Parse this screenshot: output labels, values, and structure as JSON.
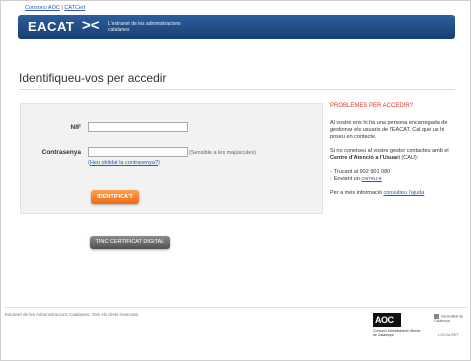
{
  "top_links": {
    "consorci": "Consorci AOC",
    "separator": "|",
    "catcert": "CATCert"
  },
  "banner": {
    "logo_text": "EACAT",
    "logo_mark": "><",
    "tagline": "L'extranet de les administracions catalanes"
  },
  "page_title": "Identifiqueu-vos per accedir",
  "form": {
    "nif_label": "NIF",
    "nif_value": "",
    "password_label": "Contrasenya",
    "password_value": "",
    "password_hint": "(Sensible a les majúscules)",
    "forgot_link": "Heu oblidat la contrasenya?",
    "forgot_prefix": "(",
    "forgot_suffix": ")",
    "submit_label": "IDENTIFICA'T"
  },
  "certificate_button": "TINC CERTIFICAT DIGITAL",
  "side": {
    "title": "PROBLEMES PER ACCEDIR?",
    "para1": "Al vostre ens hi ha una persona encarregada de gestionar els usuaris de l'EACAT. Cal que us hi poseu en contacte.",
    "para2_pre": "Si no coneixeu al vostre gestor contacteu amb el ",
    "para2_bold": "Centre d'Atenció a l'Usuari",
    "para2_post": " (CAU):",
    "phone": "Trucant al 902 901 080",
    "email_pre": "Enviant un ",
    "email_link": "correu-e",
    "more_pre": "Per a més informació ",
    "more_link": "consulteu l'ajuda"
  },
  "footer": {
    "copyright": "Extranet de les Administracions Catalanes. Tots els drets reservats.",
    "aoc_logo": "AOC",
    "aoc_sub": "Consorci Administració Oberta de Catalunya",
    "gencat": "Generalitat de Catalunya",
    "localret": "LOCALRET"
  },
  "colors": {
    "banner": "#1e4a80",
    "accent": "#ee6a12",
    "alert": "#d63a2a",
    "link": "#2a5aa8"
  }
}
